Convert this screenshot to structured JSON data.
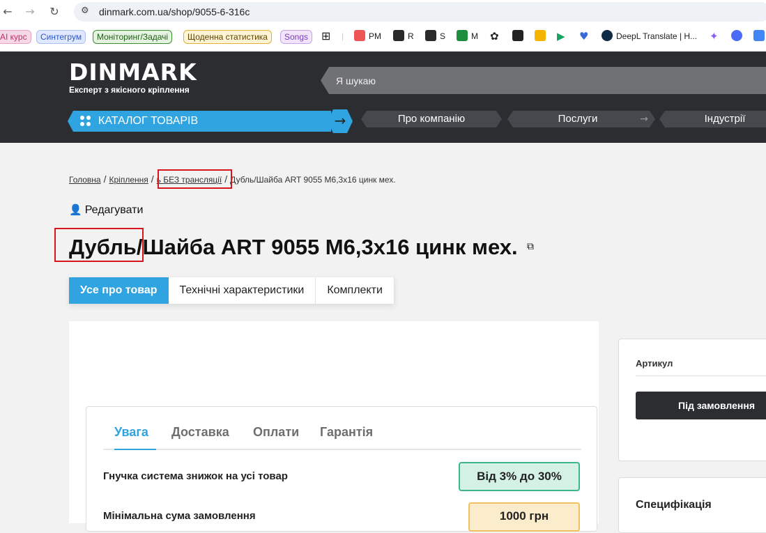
{
  "browser": {
    "url": "dinmark.com.ua/shop/9055-6-316c",
    "bookmarks": [
      {
        "label": "AI курс",
        "color": "#f6d8e6",
        "border": "#e8a0c0"
      },
      {
        "label": "Синтегрум",
        "color": "#dfe8ff",
        "border": "#a8c0f0"
      },
      {
        "label": "Моніторинг/Задачі",
        "color": "#e3f3df",
        "border": "#3a8c2f"
      },
      {
        "label": "Щоденна статистика",
        "color": "#fff4d6",
        "border": "#e0b030"
      },
      {
        "label": "Songs",
        "color": "#f1e4fb",
        "border": "#c7a2e8"
      },
      {
        "label": "PM",
        "color": "#e55",
        "border": ""
      },
      {
        "label": "R",
        "color": "#2a2a2a",
        "border": ""
      },
      {
        "label": "S",
        "color": "#2a2a2a",
        "border": ""
      },
      {
        "label": "M",
        "color": "#1e8e3e",
        "border": ""
      },
      {
        "label": "DeepL Translate | H...",
        "color": "#0f2b46",
        "border": ""
      }
    ]
  },
  "header": {
    "logo": "DINMARK",
    "tagline": "Експерт з якісного кріплення",
    "search_placeholder": "Я шукаю",
    "catalog": "КАТАЛОГ ТОВАРІВ",
    "nav": [
      "Про компанію",
      "Послуги",
      "Індустрії"
    ]
  },
  "breadcrumb": [
    "Головна",
    "Кріплення",
    "ь БЕЗ трансляції",
    "Дубль/Шайба ART 9055 M6,3x16 цинк мех."
  ],
  "edit_label": "Редагувати",
  "product_title": "Дубль/Шайба ART 9055 M6,3x16 цинк мех.",
  "tabs": [
    "Усе про товар",
    "Технічні характеристики",
    "Комплекти"
  ],
  "info": {
    "tabs": [
      "Увага",
      "Доставка",
      "Оплати",
      "Гарантія"
    ],
    "rows": [
      {
        "label": "Гнучка система знижок на усі товар",
        "value": "Від 3% до 30%"
      },
      {
        "label": "Мінімальна сума замовлення",
        "value": "1000 грн"
      }
    ]
  },
  "sidebar": {
    "article_label": "Артикул",
    "order_button": "Під замовлення",
    "spec_label": "Специфікація"
  }
}
